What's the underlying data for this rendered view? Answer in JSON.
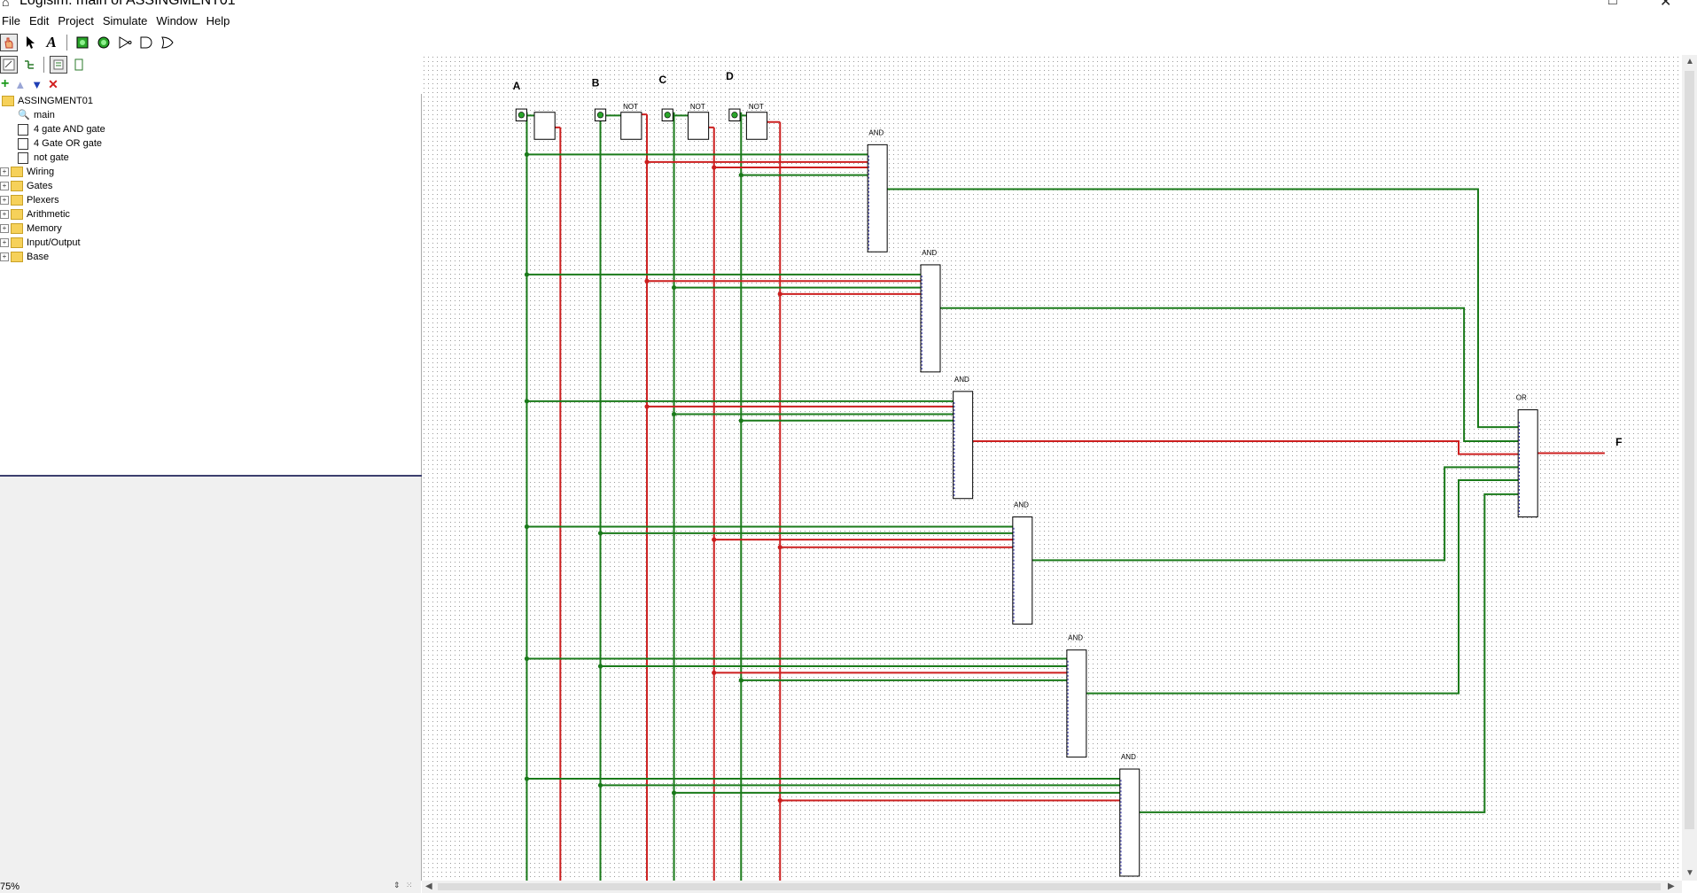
{
  "window": {
    "title": "Logisim: main of ASSINGMENT01"
  },
  "menu": [
    "File",
    "Edit",
    "Project",
    "Simulate",
    "Window",
    "Help"
  ],
  "toolbar": {
    "tools": [
      "hand-poke-icon",
      "arrow-select-icon",
      "text-tool-icon",
      "input-pin-icon",
      "output-pin-icon",
      "not-gate-icon",
      "and-gate-icon",
      "or-gate-icon"
    ]
  },
  "tree": {
    "root": "ASSINGMENT01",
    "circuits": [
      "main",
      "4 gate AND gate",
      "4 Gate OR gate",
      "not gate"
    ],
    "libraries": [
      "Wiring",
      "Gates",
      "Plexers",
      "Arithmetic",
      "Memory",
      "Input/Output",
      "Base"
    ]
  },
  "zoom": "75%",
  "circuit": {
    "inputs": [
      "A",
      "B",
      "C",
      "D"
    ],
    "not_label": "NOT",
    "and_label": "AND",
    "or_label": "OR",
    "output": "F"
  },
  "colors": {
    "wire_high": "#1a7a1a",
    "wire_low": "#cc1f1f",
    "dot": "#777777",
    "gate": "#000000"
  }
}
